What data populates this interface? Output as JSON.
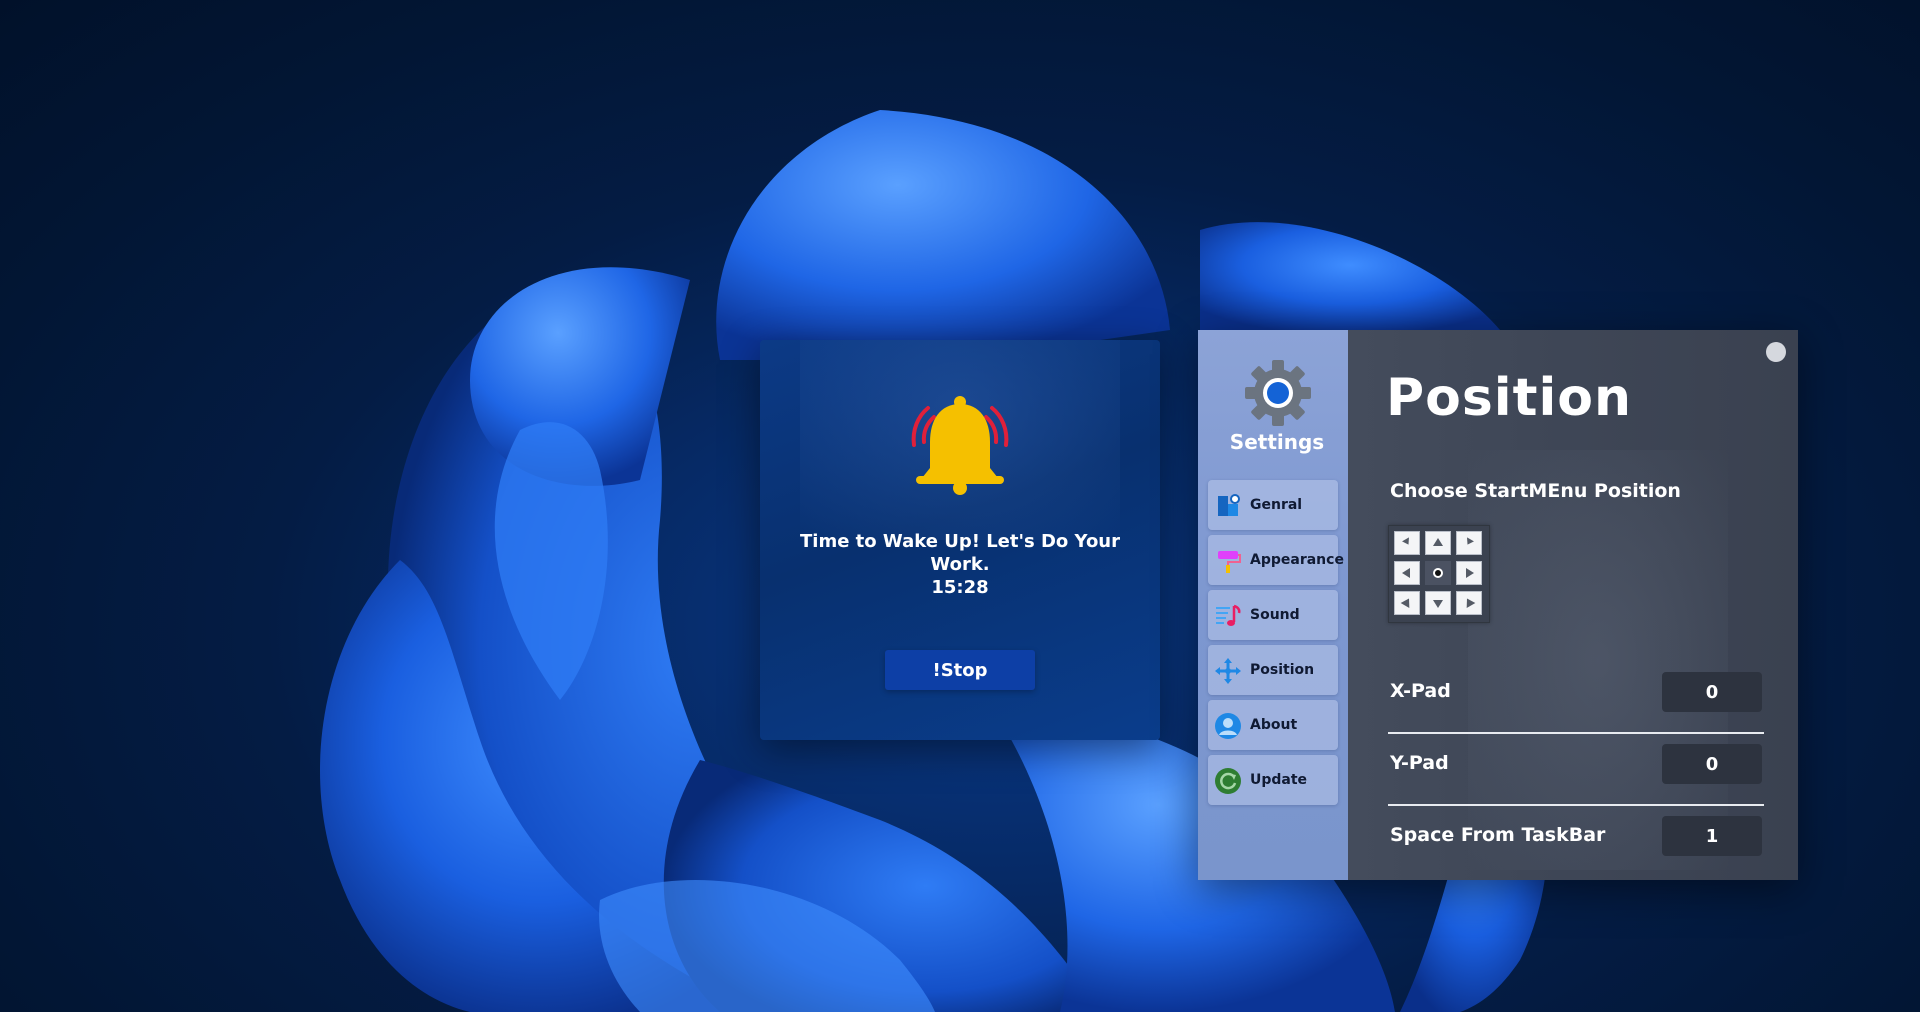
{
  "alarm": {
    "message": "Time to Wake Up! Let's Do Your Work.",
    "time": "15:28",
    "stop_label": "!Stop",
    "bell_color": "#f5c000",
    "ring_color": "#e0203a"
  },
  "settings": {
    "title": "Settings",
    "nav": [
      {
        "label": "Genral",
        "icon": "general-icon"
      },
      {
        "label": "Appearance",
        "icon": "paint-roller-icon"
      },
      {
        "label": "Sound",
        "icon": "music-note-icon"
      },
      {
        "label": "Position",
        "icon": "move-arrows-icon"
      },
      {
        "label": "About",
        "icon": "user-avatar-icon"
      },
      {
        "label": "Update",
        "icon": "refresh-icon"
      }
    ],
    "page_title": "Position",
    "choose_label": "Choose StartMEnu Position",
    "position_grid": {
      "selected": "center",
      "cells": [
        "top-left",
        "top",
        "top-right",
        "left",
        "center",
        "right",
        "bottom-left",
        "bottom",
        "bottom-right"
      ]
    },
    "x_pad": {
      "label": "X-Pad",
      "value": "0"
    },
    "y_pad": {
      "label": "Y-Pad",
      "value": "0"
    },
    "space_from_taskbar": {
      "label": "Space From TaskBar",
      "value": "1"
    }
  },
  "colors": {
    "sidebar": "#8ca3d7",
    "content_bg": "#3f4757",
    "stop_button": "#0d3fa6",
    "accent_blue": "#1463d6"
  }
}
